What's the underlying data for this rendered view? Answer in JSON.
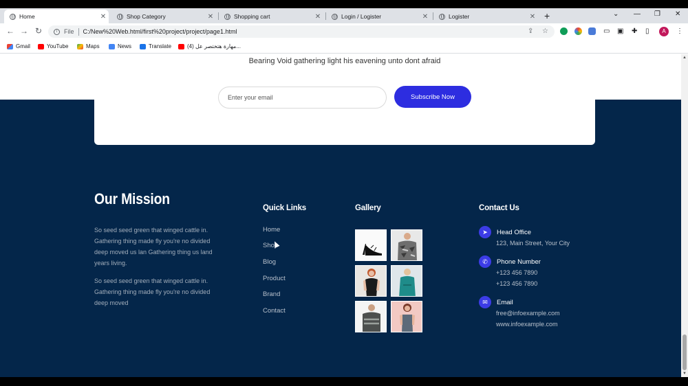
{
  "browser": {
    "tabs": [
      {
        "title": "Home"
      },
      {
        "title": "Shop Category"
      },
      {
        "title": "Shopping cart"
      },
      {
        "title": "Login / Logister"
      },
      {
        "title": "Logister"
      }
    ],
    "address": {
      "scheme_label": "File",
      "url": "C:/New%20Web.html/first%20project/project/page1.html"
    },
    "bookmarks": [
      {
        "label": "Gmail"
      },
      {
        "label": "YouTube"
      },
      {
        "label": "Maps"
      },
      {
        "label": "News"
      },
      {
        "label": "Translate"
      },
      {
        "label": "(4) مهارة هتختصر عل..."
      }
    ],
    "profile_initial": "A"
  },
  "subscribe": {
    "tagline": "Bearing Void gathering light his eavening unto dont afraid",
    "email_placeholder": "Enter your email",
    "button_label": "Subscribe Now"
  },
  "footer": {
    "mission": {
      "title": "Our Mission",
      "paragraphs": [
        "So seed seed green that winged cattle in. Gathering thing made fly you're no divided deep moved us lan Gathering thing us land years living.",
        "So seed seed green that winged cattle in. Gathering thing made fly you're no divided deep moved"
      ]
    },
    "quick_links": {
      "title": "Quick Links",
      "items": [
        "Home",
        "Shop",
        "Blog",
        "Product",
        "Brand",
        "Contact"
      ]
    },
    "gallery": {
      "title": "Gallery",
      "images": [
        "high-heel-shoe",
        "camo-tshirt-man",
        "black-top-woman",
        "teal-dress-woman",
        "grey-tshirt-man",
        "tank-top-woman"
      ]
    },
    "contact": {
      "title": "Contact Us",
      "blocks": [
        {
          "icon": "location-arrow-icon",
          "heading": "Head Office",
          "lines": [
            "123, Main Street, Your City"
          ]
        },
        {
          "icon": "phone-icon",
          "heading": "Phone Number",
          "lines": [
            "+123 456 7890",
            "+123 456 7890"
          ]
        },
        {
          "icon": "envelope-icon",
          "heading": "Email",
          "lines": [
            "free@infoexample.com",
            "www.infoexample.com"
          ]
        }
      ]
    }
  },
  "colors": {
    "footer_bg": "#04264a",
    "accent": "#2d2de0"
  }
}
